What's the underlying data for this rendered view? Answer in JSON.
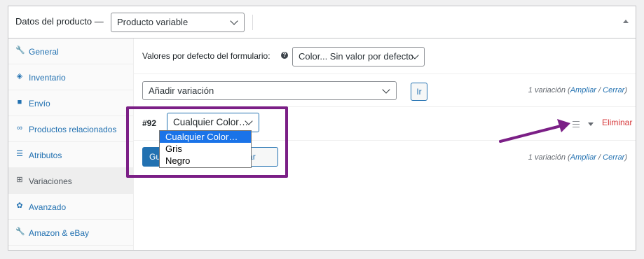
{
  "header": {
    "title": "Datos del producto —",
    "product_type": "Producto variable"
  },
  "sidebar": {
    "items": [
      {
        "label": "General",
        "icon": "wrench-icon"
      },
      {
        "label": "Inventario",
        "icon": "tag-icon"
      },
      {
        "label": "Envío",
        "icon": "truck-icon"
      },
      {
        "label": "Productos relacionados",
        "icon": "link-icon"
      },
      {
        "label": "Atributos",
        "icon": "list-icon"
      },
      {
        "label": "Variaciones",
        "icon": "grid-icon"
      },
      {
        "label": "Avanzado",
        "icon": "gear-icon"
      },
      {
        "label": "Amazon & eBay",
        "icon": "wrench-icon"
      }
    ]
  },
  "defaults": {
    "label": "Valores por defecto del formulario:",
    "value": "Color... Sin valor por defecto"
  },
  "actions": {
    "select_value": "Añadir variación",
    "go_label": "Ir",
    "count_top": {
      "prefix": "1 variación (",
      "expand": "Ampliar",
      "sep": " / ",
      "close": "Cerrar",
      "suffix": ")"
    }
  },
  "variation": {
    "id": "#92",
    "select_value": "Cualquier Color…",
    "remove_label": "Eliminar",
    "options": [
      "Cualquier Color…",
      "Gris",
      "Negro"
    ]
  },
  "footer": {
    "save_label": "Gu",
    "cancel_label": "ncelar",
    "count_bottom": {
      "prefix": "1 variación (",
      "expand": "Ampliar",
      "sep": " / ",
      "close": "Cerrar",
      "suffix": ")"
    }
  },
  "colors": {
    "annotation": "#7b1f86",
    "primary": "#2271b1",
    "danger": "#d63638"
  }
}
